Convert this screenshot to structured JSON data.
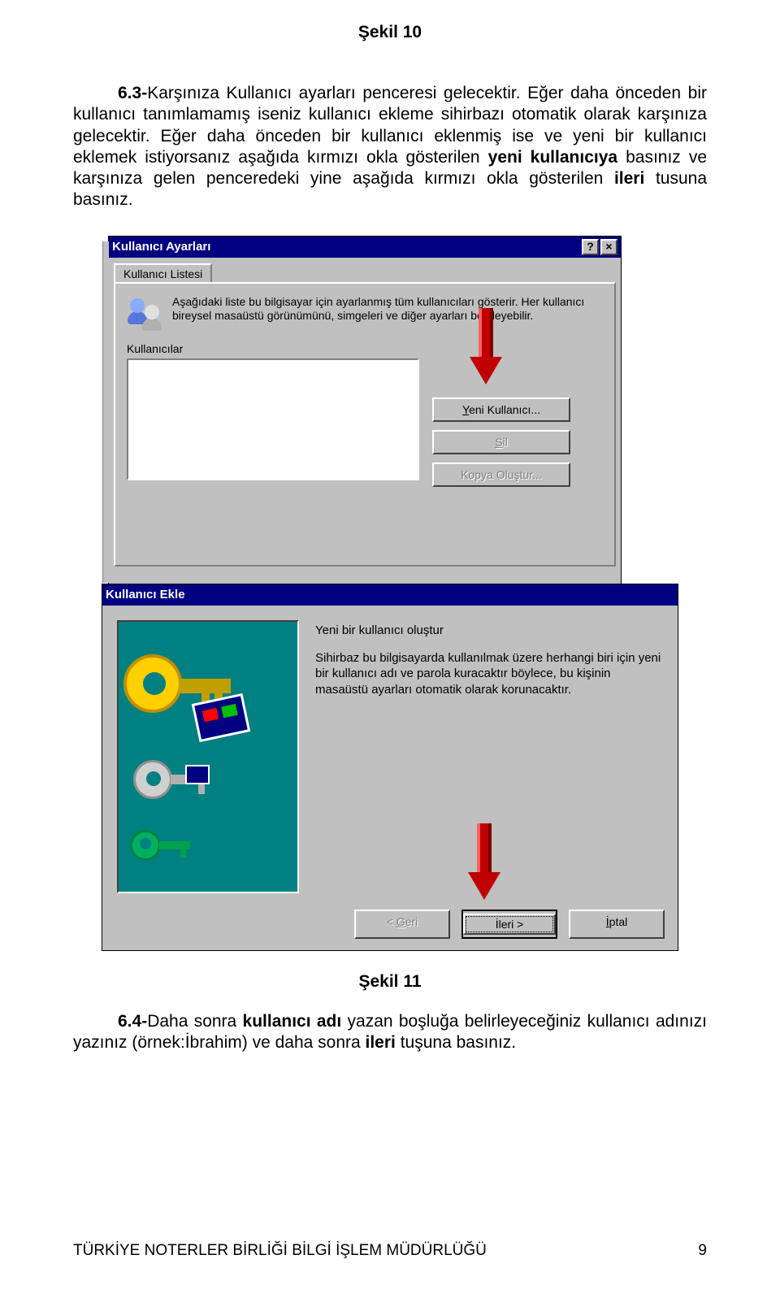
{
  "title_top": "Şekil 10",
  "para1_prefix": "6.3-",
  "para1_a": "Karşınıza Kullanıcı ayarları penceresi gelecektir. Eğer daha önceden bir kullanıcı tanımlamamış iseniz kullanıcı ekleme sihirbazı otomatik olarak karşınıza gelecektir. Eğer daha önceden bir kullanıcı eklenmiş ise ve yeni bir kullanıcı eklemek istiyorsanız aşağıda kırmızı okla gösterilen ",
  "para1_bold1": "yeni kullanıcıya",
  "para1_b": " basınız ve karşınıza gelen penceredeki yine aşağıda kırmızı okla gösterilen ",
  "para1_bold2": "ileri",
  "para1_c": " tusuna basınız.",
  "win1": {
    "title": "Kullanıcı Ayarları",
    "help": "?",
    "close": "×",
    "tab": "Kullanıcı Listesi",
    "info": "Aşağıdaki liste bu bilgisayar için ayarlanmış tüm kullanıcıları gösterir. Her kullanıcı bireysel masaüstü görünümünü, simgeleri ve diğer ayarları belirleyebilir.",
    "section": "Kullanıcılar",
    "btn_new_pre": "Y",
    "btn_new_post": "eni Kullanıcı...",
    "btn_del_pre": "S",
    "btn_del_post": "il",
    "btn_copy": "Kopya Oluştur..."
  },
  "win2": {
    "title": "Kullanıcı Ekle",
    "heading": "Yeni bir kullanıcı oluştur",
    "body": "Sihirbaz bu bilgisayarda kullanılmak üzere herhangi biri için yeni bir kullanıcı adı ve parola kuracaktır böylece, bu kişinin masaüstü ayarları otomatik olarak korunacaktır.",
    "back_pre": "< ",
    "back_ul": "G",
    "back_post": "eri",
    "next_ul": "İ",
    "next_post": "leri >",
    "cancel_ul": "İ",
    "cancel_post": "ptal"
  },
  "caption2": "Şekil 11",
  "para2_prefix": "6.4-",
  "para2_a": "Daha sonra ",
  "para2_bold1": "kullanıcı adı",
  "para2_b": " yazan boşluğa belirleyeceğiniz kullanıcı adınızı yazınız (örnek:İbrahim) ve daha sonra ",
  "para2_bold2": "ileri",
  "para2_c": " tuşuna basınız.",
  "footer_left": "TÜRKİYE NOTERLER BİRLİĞİ BİLGİ İŞLEM MÜDÜRLÜĞÜ",
  "footer_right": "9"
}
